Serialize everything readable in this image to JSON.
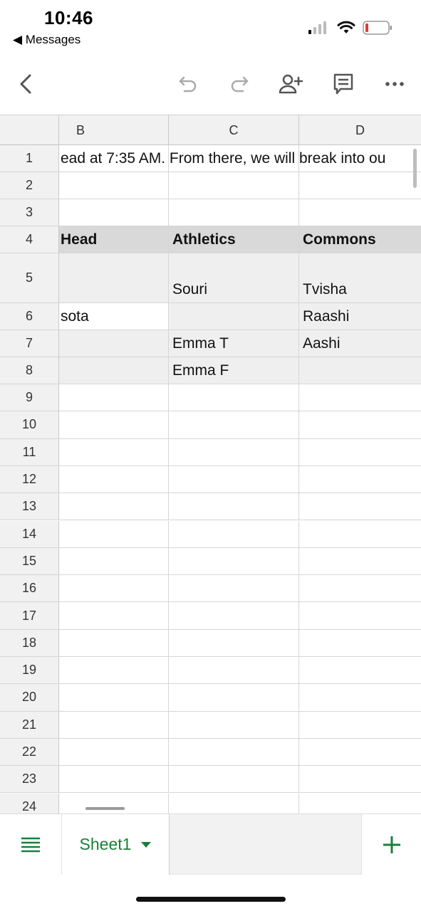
{
  "status": {
    "time": "10:46",
    "back_app": "◀ Messages"
  },
  "sheet": {
    "columns": [
      "B",
      "C",
      "D"
    ],
    "rows": [
      {
        "num": "1",
        "overflow": "ead at 7:35 AM. From there, we will break into ou",
        "b": "",
        "c": "",
        "d": ""
      },
      {
        "num": "2",
        "b": "",
        "c": "",
        "d": ""
      },
      {
        "num": "3",
        "b": "",
        "c": "",
        "d": ""
      },
      {
        "num": "4",
        "b": "Head",
        "c": "Athletics",
        "d": "Commons"
      },
      {
        "num": "5",
        "b": "",
        "c": "Souri",
        "d": "Tvisha"
      },
      {
        "num": "6",
        "b": "sota",
        "c": "",
        "d": "Raashi"
      },
      {
        "num": "7",
        "b": "",
        "c": "Emma T",
        "d": "Aashi"
      },
      {
        "num": "8",
        "b": "",
        "c": "Emma F",
        "d": ""
      },
      {
        "num": "9"
      },
      {
        "num": "10"
      },
      {
        "num": "11"
      },
      {
        "num": "12"
      },
      {
        "num": "13"
      },
      {
        "num": "14"
      },
      {
        "num": "15"
      },
      {
        "num": "16"
      },
      {
        "num": "17"
      },
      {
        "num": "18"
      },
      {
        "num": "19"
      },
      {
        "num": "20"
      },
      {
        "num": "21"
      },
      {
        "num": "22"
      },
      {
        "num": "23"
      },
      {
        "num": "24"
      }
    ]
  },
  "tabs": {
    "sheet_name": "Sheet1"
  },
  "colors": {
    "accent_green": "#188038"
  }
}
